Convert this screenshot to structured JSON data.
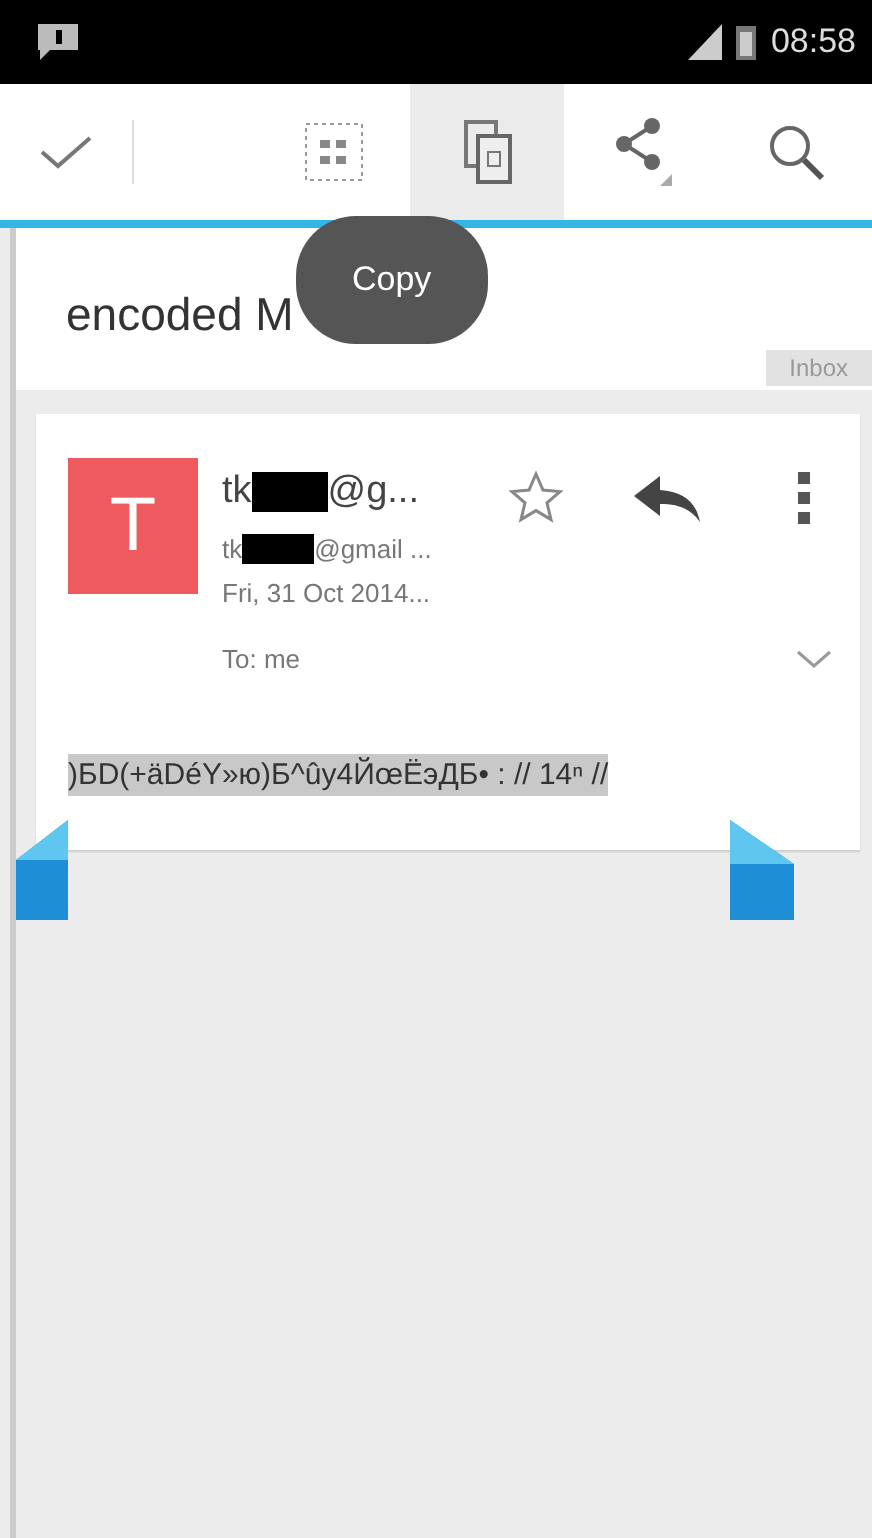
{
  "status_bar": {
    "time": "08:58"
  },
  "action_bar": {
    "actions": [
      {
        "kind": "done",
        "selected": false
      },
      {
        "kind": "select_all",
        "selected": false
      },
      {
        "kind": "copy",
        "selected": true
      },
      {
        "kind": "share",
        "selected": false
      },
      {
        "kind": "search",
        "selected": false
      }
    ]
  },
  "tooltip": "Copy",
  "conversation": {
    "subject": "encoded M",
    "label": "Inbox"
  },
  "message": {
    "avatar_letter": "T",
    "sender_prefix": "tk",
    "sender_suffix": "@g...",
    "address_prefix": "tk",
    "address_suffix": "@gmail ...",
    "date": "Fri, 31 Oct 2014...",
    "recipients": "To: me",
    "starred": false,
    "body": ")БD(+äDéY»ю)Б^ûy4ЙœЁэДБ• : // 14ⁿ //",
    "body_selected": true
  }
}
